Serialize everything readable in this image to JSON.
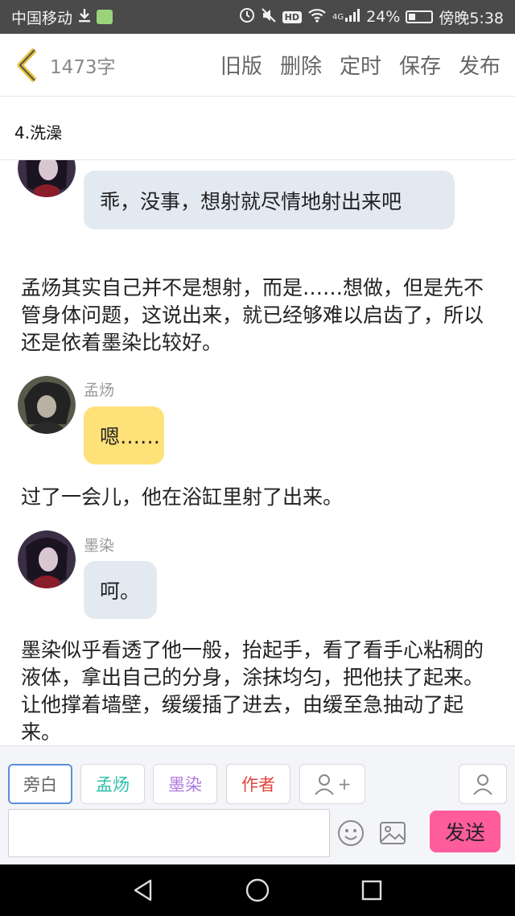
{
  "status": {
    "carrier": "中国移动",
    "net_type": "4G",
    "battery": "24%",
    "time": "傍晚5:38"
  },
  "header": {
    "word_count": "1473字",
    "actions": [
      "旧版",
      "删除",
      "定时",
      "保存",
      "发布"
    ]
  },
  "chapter": {
    "title": "4.洗澡"
  },
  "messages": [
    {
      "kind": "bubble",
      "speaker": "墨染",
      "show_name": false,
      "text": "乖，没事，想射就尽情地射出来吧",
      "color": "#e3e9f1"
    },
    {
      "kind": "narration",
      "text": "孟炀其实自己并不是想射，而是……想做，但是先不管身体问题，这说出来，就已经够难以启齿了，所以还是依着墨染比较好。"
    },
    {
      "kind": "bubble",
      "speaker": "孟炀",
      "show_name": true,
      "text": "嗯……",
      "color": "#ffe17a"
    },
    {
      "kind": "narration",
      "text": "过了一会儿，他在浴缸里射了出来。"
    },
    {
      "kind": "bubble",
      "speaker": "墨染",
      "show_name": true,
      "text": "呵。",
      "color": "#e3e9f1"
    },
    {
      "kind": "narration",
      "text": "墨染似乎看透了他一般，抬起手，看了看手心粘稠的液体，拿出自己的分身，涂抹均匀，把他扶了起来。让他撑着墙壁，缓缓插了进去，由缓至急抽动了起来。"
    }
  ],
  "roles": [
    {
      "label": "旁白",
      "color": "#666666",
      "active": true
    },
    {
      "label": "孟炀",
      "color": "#2bbfa8",
      "active": false
    },
    {
      "label": "墨染",
      "color": "#b07ae0",
      "active": false
    },
    {
      "label": "作者",
      "color": "#e0453a",
      "active": false
    }
  ],
  "add_role_label": "+",
  "composer": {
    "value": "",
    "placeholder": "",
    "send_label": "发送"
  },
  "icons": {
    "back": "chevron-left-icon",
    "emoji": "emoji-icon",
    "image": "image-icon",
    "add_role": "add-person-icon",
    "contacts": "person-icon"
  }
}
